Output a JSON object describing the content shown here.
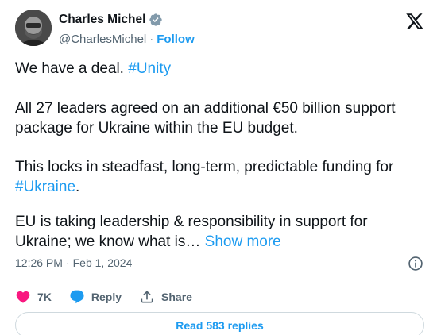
{
  "author": {
    "name": "Charles Michel",
    "handle": "@CharlesMichel",
    "separator": "·",
    "follow_label": "Follow"
  },
  "tweet": {
    "p1_text": "We have a deal. ",
    "p1_hashtag": "#Unity",
    "p2_text": "All 27 leaders agreed on an additional €50 billion support package for Ukraine within the EU budget.",
    "p3_text": "This locks in steadfast, long-term, predictable funding for ",
    "p3_hashtag": "#Ukraine",
    "p3_tail": ".",
    "p4_text": "EU is taking leadership & responsibility in support for Ukraine; we know what is…",
    "show_more_label": "Show more"
  },
  "meta": {
    "time": "12:26 PM",
    "separator": "·",
    "date": "Feb 1, 2024"
  },
  "actions": {
    "like_count": "7K",
    "reply_label": "Reply",
    "share_label": "Share"
  },
  "replies_button": "Read 583 replies",
  "colors": {
    "accent": "#1d9bf0",
    "like": "#f91880",
    "text": "#0f1419",
    "secondary": "#536471"
  },
  "icons": {
    "verified": "verified-badge-icon",
    "x_logo": "x-logo-icon",
    "info": "info-icon",
    "like": "heart-icon",
    "reply": "speech-bubble-icon",
    "share": "share-icon"
  }
}
